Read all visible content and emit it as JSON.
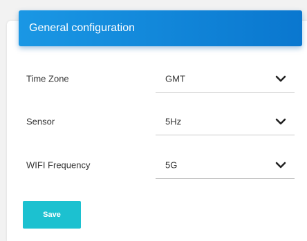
{
  "panel": {
    "title": "General configuration"
  },
  "settings": [
    {
      "label": "Time Zone",
      "value": "GMT",
      "icon": "chevron-down-icon"
    },
    {
      "label": "Sensor",
      "value": "5Hz",
      "icon": "chevron-down-icon"
    },
    {
      "label": "WIFI Frequency",
      "value": "5G",
      "icon": "chevron-down-icon"
    }
  ],
  "actions": {
    "save_label": "Save"
  },
  "colors": {
    "header_start": "#1a97e4",
    "header_end": "#0a77cf",
    "save_button": "#1cc1d0",
    "text": "#333333"
  }
}
